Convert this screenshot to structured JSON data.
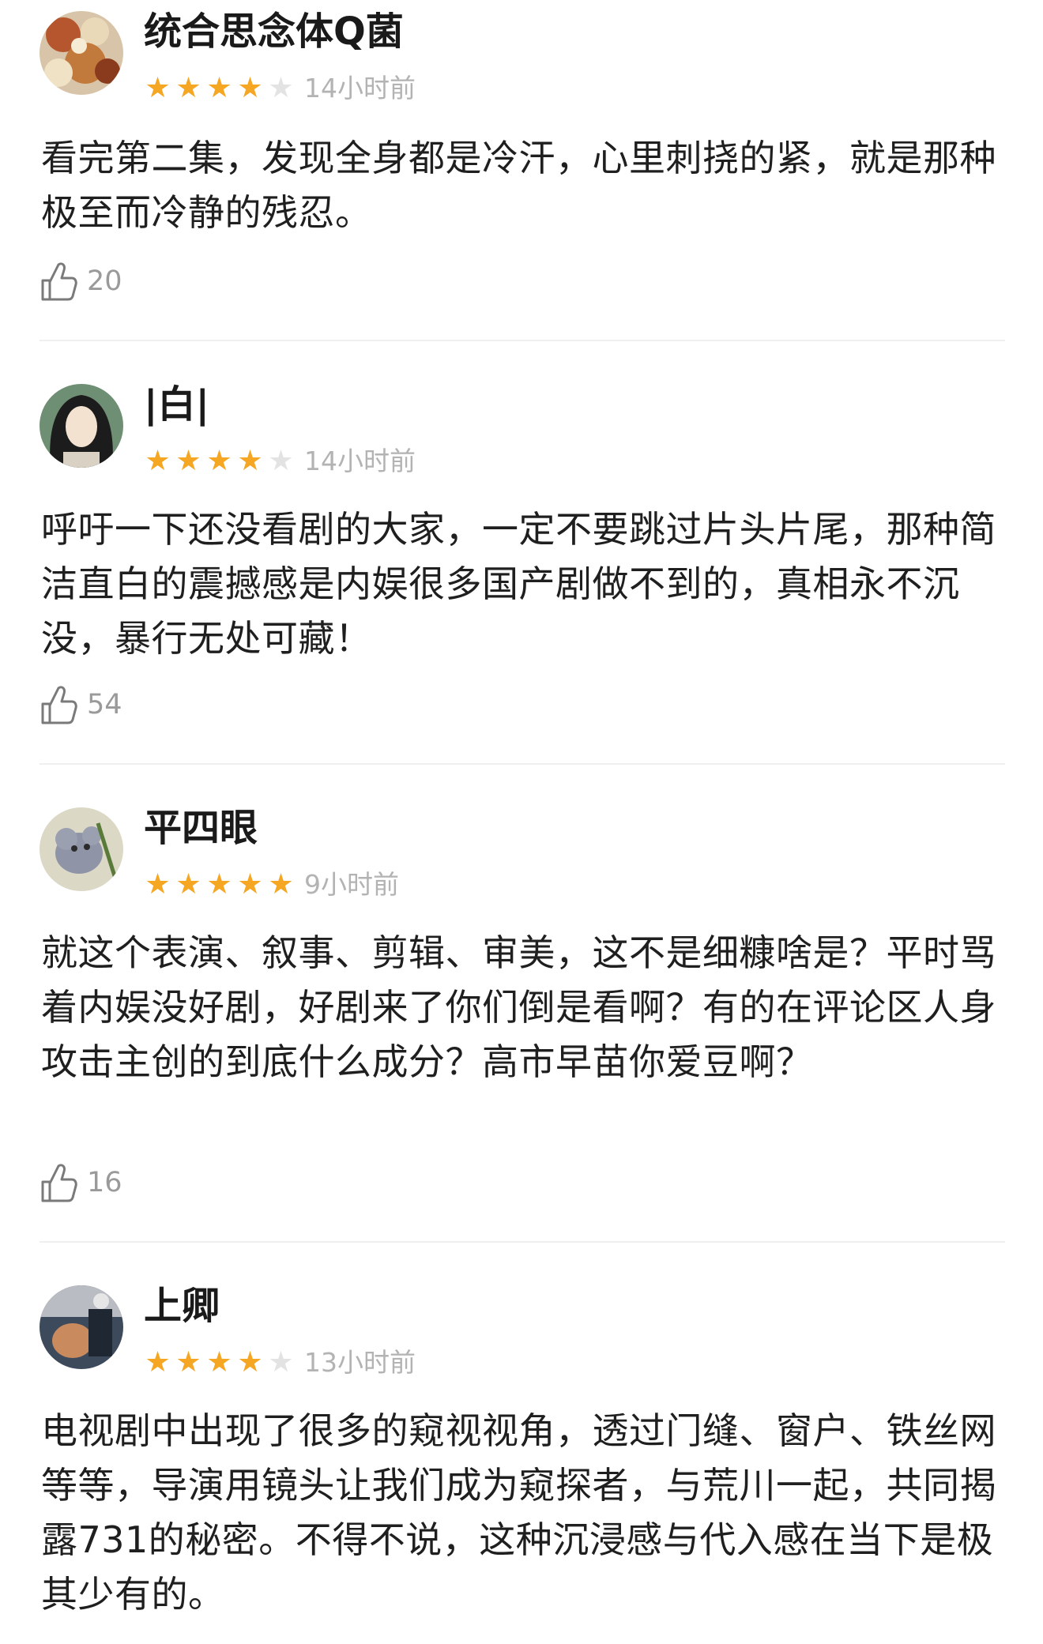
{
  "reviews": [
    {
      "username": "统合思念体Q菌",
      "rating": 4,
      "time": "14小时前",
      "content": "看完第二集，发现全身都是冷汗，心里刺挠的紧，就是那种极至而冷静的残忍。",
      "likes": "20",
      "avatar_icon": "avatar-icon"
    },
    {
      "username": "|白|",
      "rating": 4,
      "time": "14小时前",
      "content": "呼吁一下还没看剧的大家，一定不要跳过片头片尾，那种简洁直白的震撼感是内娱很多国产剧做不到的，真相永不沉没，暴行无处可藏！",
      "likes": "54",
      "avatar_icon": "avatar-icon"
    },
    {
      "username": "平四眼",
      "rating": 5,
      "time": "9小时前",
      "content": "就这个表演、叙事、剪辑、审美，这不是细糠啥是？平时骂着内娱没好剧，好剧来了你们倒是看啊？有的在评论区人身攻击主创的到底什么成分？高市早苗你爱豆啊？",
      "likes": "16",
      "avatar_icon": "avatar-icon"
    },
    {
      "username": "上卿",
      "rating": 4,
      "time": "13小时前",
      "content": "电视剧中出现了很多的窥视视角，透过门缝、窗户、铁丝网等等，导演用镜头让我们成为窥探者，与荒川一起，共同揭露731的秘密。不得不说，这种沉浸感与代入感在当下是极其少有的。",
      "likes": "",
      "avatar_icon": "avatar-icon"
    }
  ],
  "colors": {
    "star_on": "#f5a623",
    "star_off": "#e3e3e3",
    "time": "#b3b3b3",
    "divider": "#efefef"
  },
  "icons": {
    "like": "thumbs-up-icon",
    "star": "star-icon"
  }
}
